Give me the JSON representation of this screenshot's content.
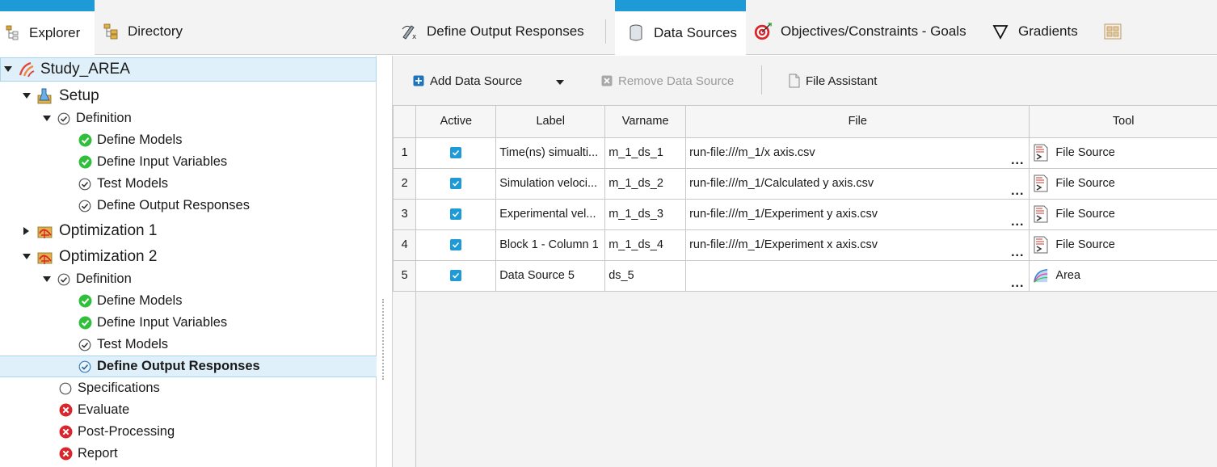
{
  "left_tabs": [
    {
      "label": "Explorer",
      "icon": "explorer-icon",
      "active": true
    },
    {
      "label": "Directory",
      "icon": "directory-icon",
      "active": false
    }
  ],
  "tree": {
    "root": "Study_AREA",
    "setup": "Setup",
    "setup_definition": "Definition",
    "setup_items": [
      "Define Models",
      "Define Input Variables",
      "Test Models",
      "Define Output Responses"
    ],
    "opt1": "Optimization 1",
    "opt2": "Optimization 2",
    "opt2_definition": "Definition",
    "opt2_items": [
      "Define Models",
      "Define Input Variables",
      "Test Models",
      "Define Output Responses"
    ],
    "opt2_steps": [
      "Specifications",
      "Evaluate",
      "Post-Processing",
      "Report"
    ]
  },
  "right_tabs": [
    {
      "label": "Define Output Responses",
      "icon": "define-output-icon"
    },
    {
      "label": "Data Sources",
      "icon": "database-icon"
    },
    {
      "label": "Objectives/Constraints - Goals",
      "icon": "target-icon"
    },
    {
      "label": "Gradients",
      "icon": "nabla-icon"
    },
    {
      "label": "",
      "icon": "layout-grid-icon"
    }
  ],
  "toolbar": {
    "add": "Add Data Source",
    "remove": "Remove Data Source",
    "assistant": "File Assistant"
  },
  "table": {
    "headers": [
      "Active",
      "Label",
      "Varname",
      "File",
      "Tool"
    ],
    "rows": [
      {
        "num": "1",
        "label": "Time(ns) simualti...",
        "varname": "m_1_ds_1",
        "file": "run-file:///m_1/x axis.csv",
        "dots": "...",
        "tool": "File Source",
        "tool_icon": "file-source-icon"
      },
      {
        "num": "2",
        "label": "Simulation veloci...",
        "varname": "m_1_ds_2",
        "file": "run-file:///m_1/Calculated y axis.csv",
        "dots": "...",
        "tool": "File Source",
        "tool_icon": "file-source-icon"
      },
      {
        "num": "3",
        "label": "Experimental vel...",
        "varname": "m_1_ds_3",
        "file": "run-file:///m_1/Experiment y axis.csv",
        "dots": "...",
        "tool": "File Source",
        "tool_icon": "file-source-icon"
      },
      {
        "num": "4",
        "label": "Block 1 - Column 1",
        "varname": "m_1_ds_4",
        "file": "run-file:///m_1/Experiment x axis.csv",
        "dots": "...",
        "tool": "File Source",
        "tool_icon": "file-source-icon"
      },
      {
        "num": "5",
        "label": "Data Source 5",
        "varname": "ds_5",
        "file": "",
        "dots": "...",
        "tool": "Area",
        "tool_icon": "area-icon"
      }
    ]
  },
  "colors": {
    "accent": "#1e9bd7",
    "ok": "#2fbf3a",
    "error": "#d9262c",
    "selection": "#dff0fa"
  }
}
